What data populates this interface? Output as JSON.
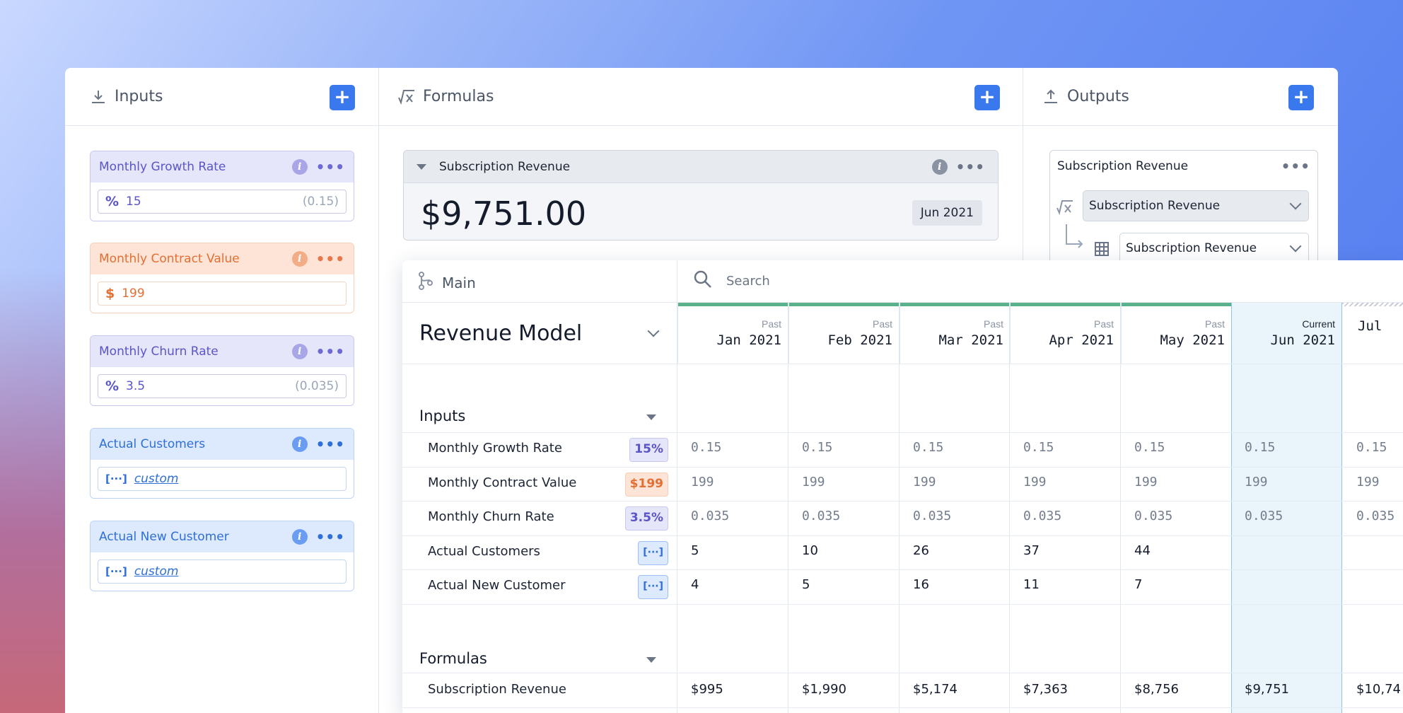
{
  "colors": {
    "accent": "#3a78ee",
    "purple": "#5a55c9",
    "orange": "#e46f33",
    "blue": "#2e6fd8",
    "green_bar": "#59b28c"
  },
  "columns": {
    "inputs": {
      "title": "Inputs",
      "icon": "download-icon"
    },
    "formulas": {
      "title": "Formulas",
      "icon": "formula-icon"
    },
    "outputs": {
      "title": "Outputs",
      "icon": "upload-icon"
    },
    "add_label": "+"
  },
  "input_cards": [
    {
      "title": "Monthly Growth Rate",
      "symbol": "%",
      "value": "15",
      "note": "(0.15)"
    },
    {
      "title": "Monthly Contract Value",
      "symbol": "$",
      "value": "199",
      "note": ""
    },
    {
      "title": "Monthly Churn Rate",
      "symbol": "%",
      "value": "3.5",
      "note": "(0.035)"
    },
    {
      "title": "Actual Customers",
      "symbol": "[···]",
      "value": "custom",
      "note": ""
    },
    {
      "title": "Actual New Customer",
      "symbol": "[···]",
      "value": "custom",
      "note": ""
    }
  ],
  "info_glyph": "i",
  "formula_card": {
    "title": "Subscription Revenue",
    "value": "$9,751.00",
    "date": "Jun 2021"
  },
  "output_card": {
    "title": "Subscription Revenue",
    "select_formula": "Subscription Revenue",
    "select_table": "Subscription Revenue"
  },
  "sheet": {
    "branch": "Main",
    "search_placeholder": "Search",
    "model_title": "Revenue Model",
    "months": [
      {
        "status": "Past",
        "label": "Jan 2021"
      },
      {
        "status": "Past",
        "label": "Feb 2021"
      },
      {
        "status": "Past",
        "label": "Mar 2021"
      },
      {
        "status": "Past",
        "label": "Apr 2021"
      },
      {
        "status": "Past",
        "label": "May 2021"
      },
      {
        "status": "Current",
        "label": "Jun 2021"
      },
      {
        "status": "",
        "label": "Jul"
      }
    ],
    "sections": {
      "inputs": "Inputs",
      "formulas": "Formulas"
    },
    "input_rows": [
      {
        "label": "Monthly Growth Rate",
        "badge": "15%",
        "values": [
          "0.15",
          "0.15",
          "0.15",
          "0.15",
          "0.15",
          "0.15",
          "0.15"
        ]
      },
      {
        "label": "Monthly Contract Value",
        "badge": "$199",
        "values": [
          "199",
          "199",
          "199",
          "199",
          "199",
          "199",
          "199"
        ]
      },
      {
        "label": "Monthly Churn Rate",
        "badge": "3.5%",
        "values": [
          "0.035",
          "0.035",
          "0.035",
          "0.035",
          "0.035",
          "0.035",
          "0.035"
        ]
      },
      {
        "label": "Actual Customers",
        "badge": "[···]",
        "values": [
          "5",
          "10",
          "26",
          "37",
          "44",
          "",
          ""
        ]
      },
      {
        "label": "Actual New Customer",
        "badge": "[···]",
        "values": [
          "4",
          "5",
          "16",
          "11",
          "7",
          "",
          ""
        ]
      }
    ],
    "formula_rows": [
      {
        "label": "Subscription Revenue",
        "values": [
          "$995",
          "$1,990",
          "$5,174",
          "$7,363",
          "$8,756",
          "$9,751",
          "$10,74"
        ]
      }
    ]
  }
}
